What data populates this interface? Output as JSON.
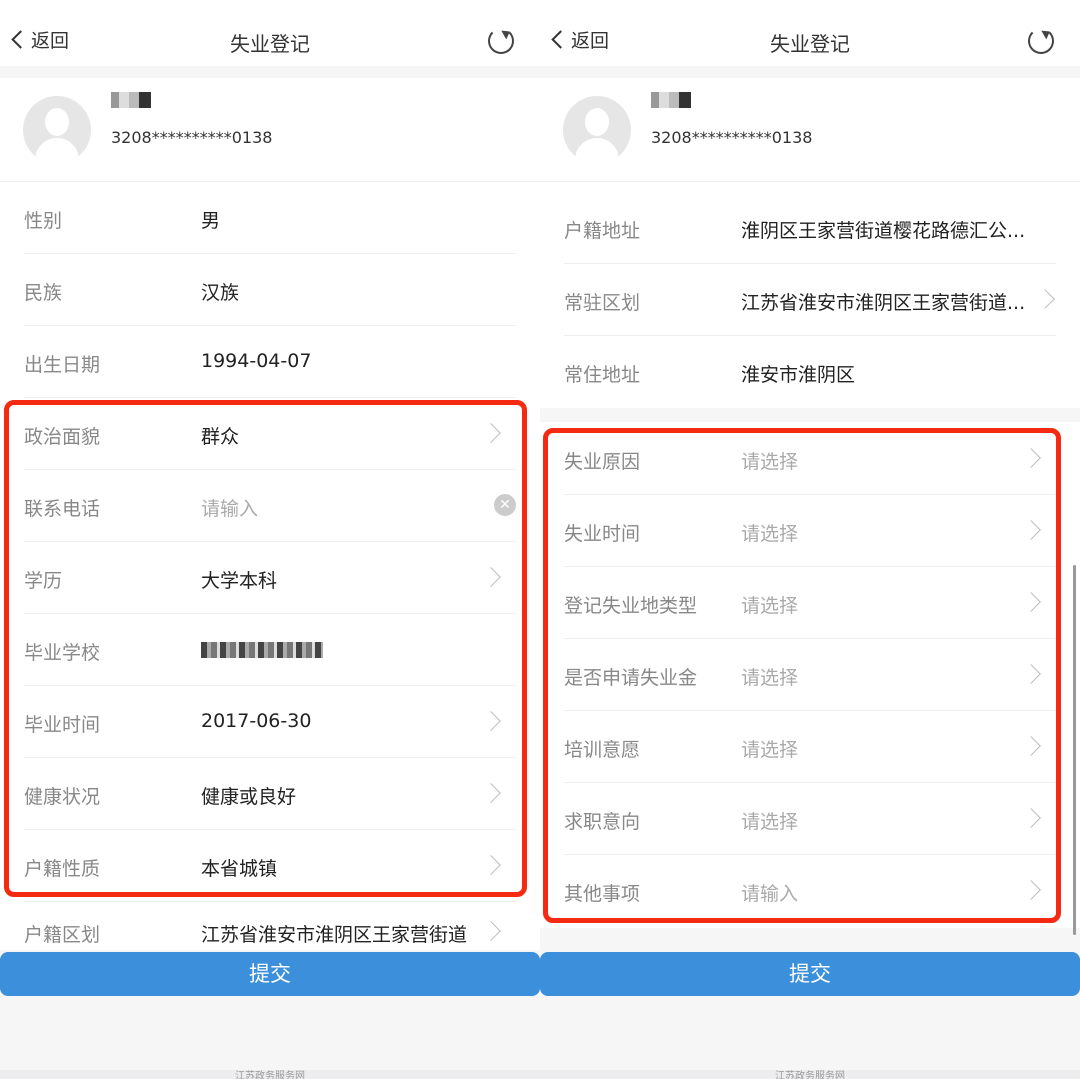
{
  "header": {
    "back_label": "返回",
    "title": "失业登记"
  },
  "profile": {
    "id_number": "3208**********0138"
  },
  "left": {
    "rows": [
      {
        "label": "性别",
        "value": "男"
      },
      {
        "label": "民族",
        "value": "汉族"
      },
      {
        "label": "出生日期",
        "value": "1994-04-07"
      },
      {
        "label": "政治面貌",
        "value": "群众"
      },
      {
        "label": "联系电话",
        "placeholder": "请输入"
      },
      {
        "label": "学历",
        "value": "大学本科"
      },
      {
        "label": "毕业学校",
        "value": ""
      },
      {
        "label": "毕业时间",
        "value": "2017-06-30"
      },
      {
        "label": "健康状况",
        "value": "健康或良好"
      },
      {
        "label": "户籍性质",
        "value": "本省城镇"
      },
      {
        "label": "户籍区划",
        "value": "江苏省淮安市淮阴区王家营街道"
      }
    ]
  },
  "right": {
    "rows_top": [
      {
        "label": "户籍地址",
        "value": "淮阴区王家营街道樱花路德汇公..."
      },
      {
        "label": "常驻区划",
        "value": "江苏省淮安市淮阴区王家营街道..."
      },
      {
        "label": "常住地址",
        "value": "淮安市淮阴区"
      }
    ],
    "rows": [
      {
        "label": "失业原因",
        "value": "请选择"
      },
      {
        "label": "失业时间",
        "value": "请选择"
      },
      {
        "label": "登记失业地类型",
        "value": "请选择"
      },
      {
        "label": "是否申请失业金",
        "value": "请选择"
      },
      {
        "label": "培训意愿",
        "value": "请选择"
      },
      {
        "label": "求职意向",
        "value": "请选择"
      },
      {
        "label": "其他事项",
        "value": "请输入"
      }
    ]
  },
  "submit_label": "提交",
  "footer": "江苏政务服务网",
  "colors": {
    "accent": "#3b8fdb",
    "highlight": "#f52a12"
  }
}
